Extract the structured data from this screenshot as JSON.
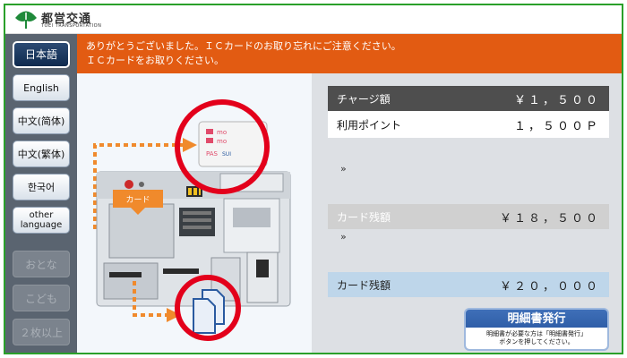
{
  "header": {
    "org_name_jp": "都営交通",
    "org_name_en": "TOEI TRANSPORTATION"
  },
  "sidebar": {
    "languages": [
      {
        "label": "日本語",
        "selected": true
      },
      {
        "label": "English",
        "selected": false
      },
      {
        "label": "中文(简体)",
        "selected": false
      },
      {
        "label": "中文(繁体)",
        "selected": false
      },
      {
        "label": "한국어",
        "selected": false
      },
      {
        "label_line1": "other",
        "label_line2": "language",
        "selected": false
      }
    ],
    "fare_buttons": [
      {
        "label": "おとな",
        "enabled": false
      },
      {
        "label": "こども",
        "enabled": false
      },
      {
        "label": "２枚以上",
        "enabled": false
      }
    ]
  },
  "banner": {
    "line1": "ありがとうございました。ＩＣカードのお取り忘れにご注意ください。",
    "line2": "ＩＣカードをお取りください。"
  },
  "illustration": {
    "card_slot_label": "カード",
    "card_text_1": "mo",
    "card_text_2": "mo",
    "card_text_3": "PAS",
    "card_text_4": "SUI"
  },
  "summary": {
    "charge_label": "チャージ額",
    "charge_value": "￥１，５００",
    "points_label": "利用ポイント",
    "points_value": "１，５００Ｐ",
    "balance_before_label": "カード残額",
    "balance_before_value": "￥１８，５００",
    "balance_after_label": "カード残額",
    "balance_after_value": "￥２０，０００",
    "chevron": "»"
  },
  "receipt": {
    "label": "明細書発行",
    "note_line1": "明細書が必要な方は「明細書発行」",
    "note_line2": "ボタンを押してください。"
  },
  "colors": {
    "frame": "#2aa02a",
    "banner": "#e25b12",
    "sidebar": "#5a6470",
    "highlight_circle": "#e3001b",
    "arrow": "#f08a2c"
  }
}
